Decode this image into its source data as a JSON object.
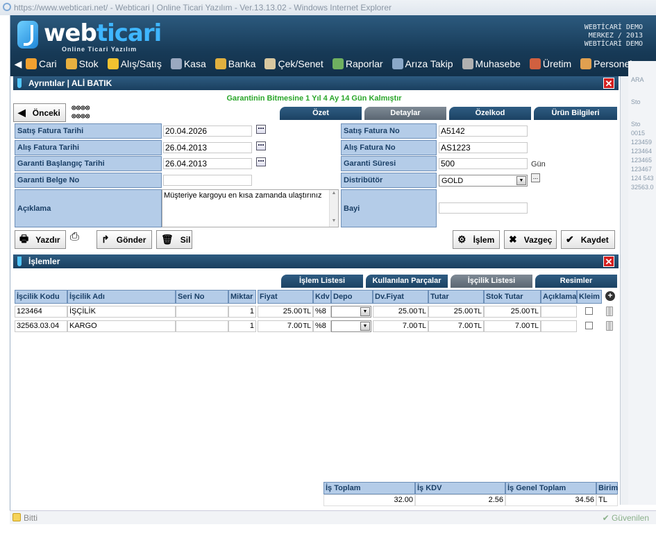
{
  "browser": {
    "title": "https://www.webticari.net/ - Webticari | Online Ticari Yazılım - Ver.13.13.02 - Windows Internet Explorer",
    "status": "Bitti",
    "zone": "Güvenilen"
  },
  "brand": {
    "logo_a": "web",
    "logo_b": "ticari",
    "subtitle": "Online Ticari Yazılım",
    "company_l1": "WEBTİCARİ DEMO",
    "company_l2": "MERKEZ / 2013",
    "company_l3": "WEBTİCARİ DEMO"
  },
  "menu": [
    {
      "label": "Cari",
      "color": "#f0a030"
    },
    {
      "label": "Stok",
      "color": "#e8b040"
    },
    {
      "label": "Alış/Satış",
      "color": "#f2c230"
    },
    {
      "label": "Kasa",
      "color": "#9aa8c0"
    },
    {
      "label": "Banka",
      "color": "#e0b040"
    },
    {
      "label": "Çek/Senet",
      "color": "#d8c8a0"
    },
    {
      "label": "Raporlar",
      "color": "#6fb060"
    },
    {
      "label": "Arıza Takip",
      "color": "#8aa8c8"
    },
    {
      "label": "Muhasebe",
      "color": "#b0b0b0"
    },
    {
      "label": "Üretim",
      "color": "#d06040"
    },
    {
      "label": "Personel",
      "color": "#e0a050"
    }
  ],
  "details": {
    "title": "Ayrıntılar | ALİ BATIK",
    "countdown": "Garantinin Bitmesine 1 Yıl 4 Ay 14 Gün Kalmıştır",
    "prev_button": "Önceki",
    "tabs": [
      "Özet",
      "Detaylar",
      "Özelkod",
      "Ürün Bilgileri"
    ],
    "labels": {
      "sales_invoice_date": "Satış Fatura Tarihi",
      "purchase_invoice_date": "Alış Fatura Tarihi",
      "warranty_start": "Garanti Başlangıç Tarihi",
      "warranty_doc": "Garanti Belge No",
      "description": "Açıklama",
      "sales_invoice_no": "Satış Fatura No",
      "purchase_invoice_no": "Alış Fatura No",
      "warranty_period": "Garanti Süresi",
      "distributor": "Distribütör",
      "dealer": "Bayi"
    },
    "values": {
      "sales_invoice_date": "20.04.2026",
      "purchase_invoice_date": "26.04.2013",
      "warranty_start": "26.04.2013",
      "warranty_doc": "",
      "description": "Müşteriye kargoyu en kısa zamanda ulaştırınız",
      "sales_invoice_no": "A5142",
      "purchase_invoice_no": "AS1223",
      "warranty_period": "500",
      "warranty_unit": "Gün",
      "distributor": "GOLD",
      "dealer": ""
    },
    "actions": {
      "print": "Yazdır",
      "send": "Gönder",
      "delete": "Sil",
      "process": "İşlem",
      "cancel": "Vazgeç",
      "save": "Kaydet"
    }
  },
  "ops": {
    "title": "İşlemler",
    "tabs": [
      "İşlem Listesi",
      "Kullanılan Parçalar",
      "İşçilik Listesi",
      "Resimler"
    ],
    "columns": [
      "İşcilik Kodu",
      "İşcilik Adı",
      "Seri No",
      "Miktar",
      "Fiyat",
      "Kdv",
      "Depo",
      "Dv.Fiyat",
      "Tutar",
      "Stok Tutar",
      "Açıklama",
      "Kleim"
    ],
    "rows": [
      {
        "code": "123464",
        "name": "İŞÇİLİK",
        "serial": "",
        "qty": "1",
        "price": "25.00",
        "cur1": "TL",
        "vat": "%8",
        "dvprice": "25.00",
        "cur2": "TL",
        "total": "25.00",
        "cur3": "TL",
        "stock_total": "25.00",
        "cur4": "TL",
        "note": ""
      },
      {
        "code": "32563.03.04",
        "name": "KARGO",
        "serial": "",
        "qty": "1",
        "price": "7.00",
        "cur1": "TL",
        "vat": "%8",
        "dvprice": "7.00",
        "cur2": "TL",
        "total": "7.00",
        "cur3": "TL",
        "stock_total": "7.00",
        "cur4": "TL",
        "note": ""
      }
    ],
    "totals": {
      "h1": "İş Toplam",
      "h2": "İş KDV",
      "h3": "İş Genel Toplam",
      "h4": "Birim",
      "v1": "32.00",
      "v2": "2.56",
      "v3": "34.56",
      "v4": "TL"
    }
  },
  "side": {
    "items": [
      "ARA",
      "Sto",
      "Sto",
      "0015",
      "123459",
      "123464",
      "123465",
      "123467",
      "124 543",
      "32563.0"
    ]
  }
}
